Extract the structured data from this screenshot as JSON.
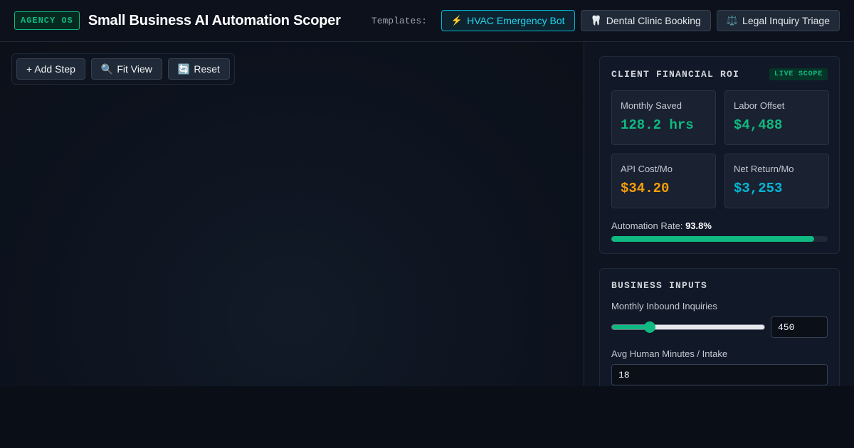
{
  "header": {
    "brand_badge": "AGENCY OS",
    "title": "Small Business AI Automation Scoper",
    "templates_label": "Templates:",
    "templates": [
      {
        "icon": "⚡",
        "label": "HVAC Emergency Bot",
        "active": true
      },
      {
        "icon": "🦷",
        "label": "Dental Clinic Booking",
        "active": false
      },
      {
        "icon": "⚖️",
        "label": "Legal Inquiry Triage",
        "active": false
      }
    ]
  },
  "toolbar": {
    "add_step": "+ Add Step",
    "fit_icon": "🔍",
    "fit_view": "Fit View",
    "reset_icon": "🔄",
    "reset": "Reset"
  },
  "roi": {
    "title": "CLIENT FINANCIAL ROI",
    "badge": "LIVE SCOPE",
    "metrics": [
      {
        "label": "Monthly Saved",
        "value": "128.2 hrs",
        "color": "#10b981"
      },
      {
        "label": "Labor Offset",
        "value": "$4,488",
        "color": "#10b981"
      },
      {
        "label": "API Cost/Mo",
        "value": "$34.20",
        "color": "#f59e0b"
      },
      {
        "label": "Net Return/Mo",
        "value": "$3,253",
        "color": "#06b6d4"
      }
    ],
    "rate_label": "Automation Rate:",
    "rate_value": "93.8%",
    "rate_fraction": 0.938
  },
  "inputs": {
    "title": "BUSINESS INPUTS",
    "inquiries_label": "Monthly Inbound Inquiries",
    "inquiries_value": "450",
    "minutes_label": "Avg Human Minutes / Intake",
    "minutes_value": "18"
  },
  "colors": {
    "accent_green": "#10b981",
    "accent_cyan": "#06b6d4",
    "accent_amber": "#f59e0b"
  }
}
